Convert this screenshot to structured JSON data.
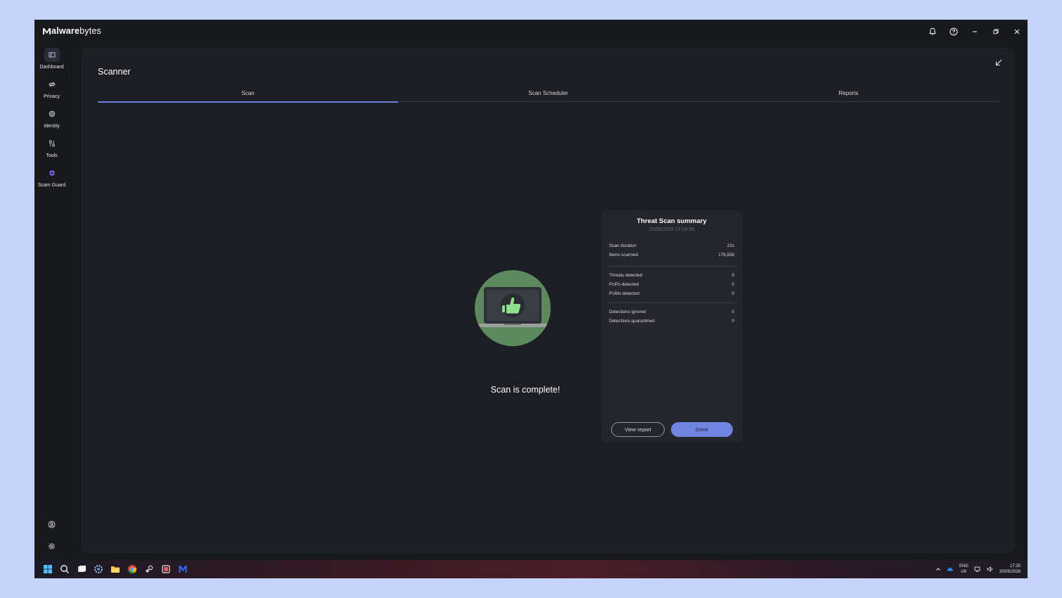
{
  "app": {
    "logo_text": "Malwarebytes",
    "logo_prefix": "M",
    "logo_bold": "alware",
    "logo_rest": "bytes"
  },
  "titlebar": {
    "icons": [
      "bell-icon",
      "help-icon",
      "minimize-icon",
      "restore-icon",
      "close-icon"
    ]
  },
  "sidebar": {
    "items": [
      {
        "label": "Dashboard",
        "icon": "dashboard-icon",
        "active": true
      },
      {
        "label": "Privacy",
        "icon": "eye-off-icon"
      },
      {
        "label": "Identity",
        "icon": "fingerprint-icon"
      },
      {
        "label": "Tools",
        "icon": "tools-icon"
      },
      {
        "label": "Scam Guard",
        "icon": "scam-guard-icon"
      }
    ],
    "bottom_icons": [
      "account-icon",
      "settings-icon"
    ]
  },
  "panel": {
    "title": "Scanner",
    "tabs": [
      {
        "label": "Scan",
        "active": true
      },
      {
        "label": "Scan Scheduler"
      },
      {
        "label": "Reports"
      }
    ]
  },
  "status": {
    "message": "Scan is complete!"
  },
  "summary": {
    "title": "Threat Scan summary",
    "date": "20/05/2026 17:24:56",
    "group1": [
      {
        "label": "Scan duration",
        "value": "22s"
      },
      {
        "label": "Items scanned",
        "value": "176,938"
      }
    ],
    "group2": [
      {
        "label": "Threats detected",
        "value": "0"
      },
      {
        "label": "PUPs detected",
        "value": "0"
      },
      {
        "label": "PUMs detected",
        "value": "0"
      }
    ],
    "group3": [
      {
        "label": "Detections ignored",
        "value": "0"
      },
      {
        "label": "Detections quarantined",
        "value": "0"
      }
    ],
    "view_report": "View report",
    "done": "Done"
  },
  "taskbar": {
    "apps": [
      "windows-start-icon",
      "search-icon",
      "task-view-icon",
      "settings-app-icon",
      "file-explorer-icon",
      "chrome-icon",
      "steam-icon",
      "snipping-tool-icon",
      "malwarebytes-icon"
    ],
    "lang_top": "ENG",
    "lang_bottom": "UK",
    "time": "17:25",
    "date": "20/05/2026"
  },
  "colors": {
    "accent": "#7184e0",
    "success": "#5c8a5e",
    "background": "#18191d"
  }
}
